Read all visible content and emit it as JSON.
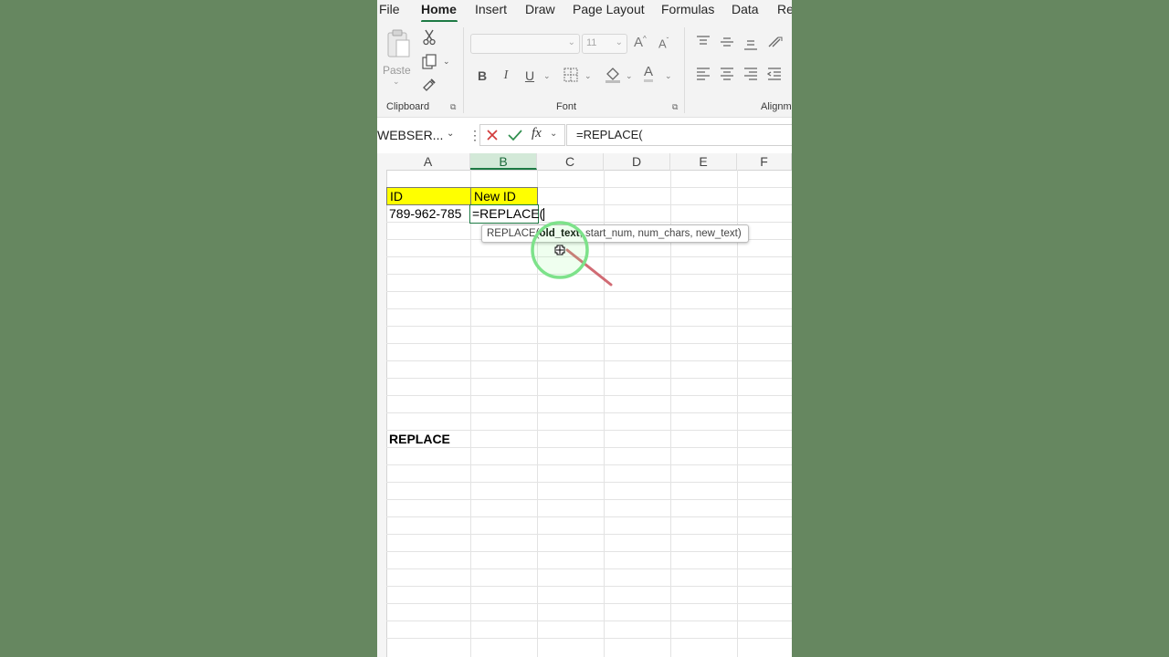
{
  "menu": {
    "tabs": [
      "File",
      "Home",
      "Insert",
      "Draw",
      "Page Layout",
      "Formulas",
      "Data",
      "Re"
    ],
    "active": "Home"
  },
  "ribbon": {
    "clipboard": {
      "paste_label": "Paste",
      "group_label": "Clipboard"
    },
    "font": {
      "font_name": "",
      "font_size": "11",
      "group_label": "Font",
      "bold": "B",
      "italic": "I",
      "underline": "U",
      "font_color_glyph": "A"
    },
    "alignment": {
      "group_label": "Alignm"
    }
  },
  "formula_bar": {
    "name_box": "WEBSER...",
    "fx": "fx",
    "formula": "=REPLACE("
  },
  "grid": {
    "columns": [
      "A",
      "B",
      "C",
      "D",
      "E",
      "F"
    ],
    "selected_column": "B",
    "cells": {
      "a_header": "ID",
      "b_header": "New ID",
      "a_value": "789-962-785",
      "b_editing": "=REPLACE(",
      "a_label": "REPLACE"
    }
  },
  "tooltip": {
    "fn": "REPLACE(",
    "arg_current": "old_text",
    "args_rest": ", start_num, num_chars, new_text)"
  },
  "colors": {
    "background": "#668760",
    "header_fill": "#ffff00",
    "accent_green": "#1d7a44"
  }
}
